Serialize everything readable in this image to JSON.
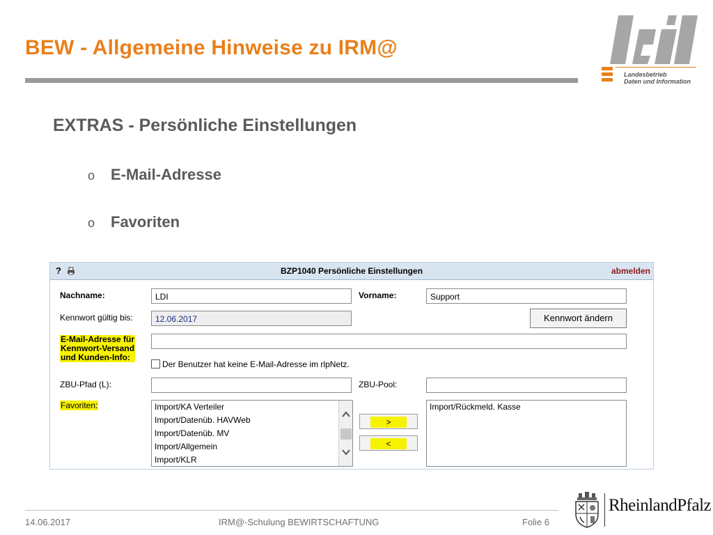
{
  "slide": {
    "title": "BEW - Allgemeine Hinweise zu IRM@",
    "section_heading": "EXTRAS - Persönliche Einstellungen",
    "bullets": [
      "E-Mail-Adresse",
      "Favoriten"
    ],
    "bullet_marker": "o"
  },
  "logo": {
    "letters": "ldi",
    "subtitle_line1": "Landesbetrieb",
    "subtitle_line2": "Daten und Information",
    "colors": {
      "gray": "#a6a6a6",
      "orange": "#e8801c"
    }
  },
  "dialog": {
    "help_label": "?",
    "title": "BZP1040 Persönliche Einstellungen",
    "logout_label": "abmelden",
    "nachname_label": "Nachname:",
    "nachname_value": "LDI",
    "vorname_label": "Vorname:",
    "vorname_value": "Support",
    "kennwort_label": "Kennwort gültig bis:",
    "kennwort_value": "12.06.2017",
    "kennwort_button": "Kennwort ändern",
    "email_label_line1": "E-Mail-Adresse für",
    "email_label_line2": "Kennwort-Versand",
    "email_label_line3": "und Kunden-Info:",
    "email_value": "",
    "no_email_checkbox_label": "Der Benutzer hat keine E-Mail-Adresse im rlpNetz.",
    "no_email_checked": false,
    "zbu_pfad_label": "ZBU-Pfad (L):",
    "zbu_pfad_value": "",
    "zbu_pool_label": "ZBU-Pool:",
    "zbu_pool_value": "",
    "favoriten_label": "Favoriten:",
    "available_items": [
      "Import/KA Verteiler",
      "Import/Datenüb. HAVWeb",
      "Import/Datenüb. MV",
      "Import/Allgemein",
      "Import/KLR"
    ],
    "add_button": ">",
    "remove_button": "<",
    "selected_items": [
      "Import/Rückmeld. Kasse"
    ],
    "highlight_color": "#f6f200"
  },
  "footer": {
    "date": "14.06.2017",
    "center": "IRM@-Schulung BEWIRTSCHAFTUNG",
    "page": "Folie 6",
    "brand": "RheinlandPfalz"
  }
}
